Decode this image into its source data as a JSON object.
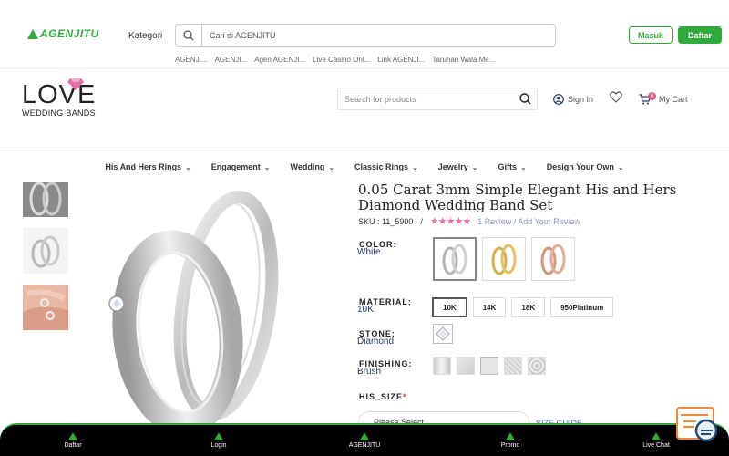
{
  "topbar": {
    "brand": "AGENJITU",
    "kategori_label": "Kategori",
    "search_placeholder": "Cari di AGENJITU",
    "masuk_label": "Masuk",
    "daftar_label": "Daftar",
    "quicklinks": [
      "AGENJI...",
      "AGENJI...",
      "Agen AGENJI...",
      "Live Casino Onl...",
      "Link AGENJI...",
      "Taruhan Wala Me..."
    ]
  },
  "header": {
    "logo_main": "LOVE",
    "logo_sub": "WEDDING BANDS",
    "search_placeholder": "Search for products",
    "signin_label": "Sign In",
    "cart_label": "My Cart",
    "cart_count": "0"
  },
  "nav": {
    "items": [
      "His And Hers Rings",
      "Engagement",
      "Wedding",
      "Classic Rings",
      "Jewelry",
      "Gifts",
      "Design Your Own"
    ]
  },
  "product": {
    "title": "0.05 Carat 3mm Simple Elegant His and Hers Diamond Wedding Band Set",
    "sku": "SKU : 11_5900",
    "separator": "/",
    "stars": "★★★★★",
    "review_link": "1 Review / Add Your Review",
    "color_label": "COLOR:",
    "color_value": "White",
    "material_label": "MATERIAL:",
    "material_value": "10K",
    "materials": [
      "10K",
      "14K",
      "18K",
      "950Platinum"
    ],
    "stone_label": "STONE:",
    "stone_value": "Diamond",
    "finishing_label": "FINISHING:",
    "finishing_value": "Brush",
    "size_label": "HIS_SIZE",
    "required_mark": "*",
    "size_placeholder": "Please Select",
    "size_guide": "SIZE GUIDE"
  },
  "bottombar": {
    "items": [
      "Daftar",
      "Login",
      "AGENJITU",
      "Promo",
      "Live Chat"
    ]
  },
  "colors": {
    "brand_green": "#2faa3c",
    "star_pink": "#e86fa6",
    "link_blue": "#3a66c4"
  }
}
